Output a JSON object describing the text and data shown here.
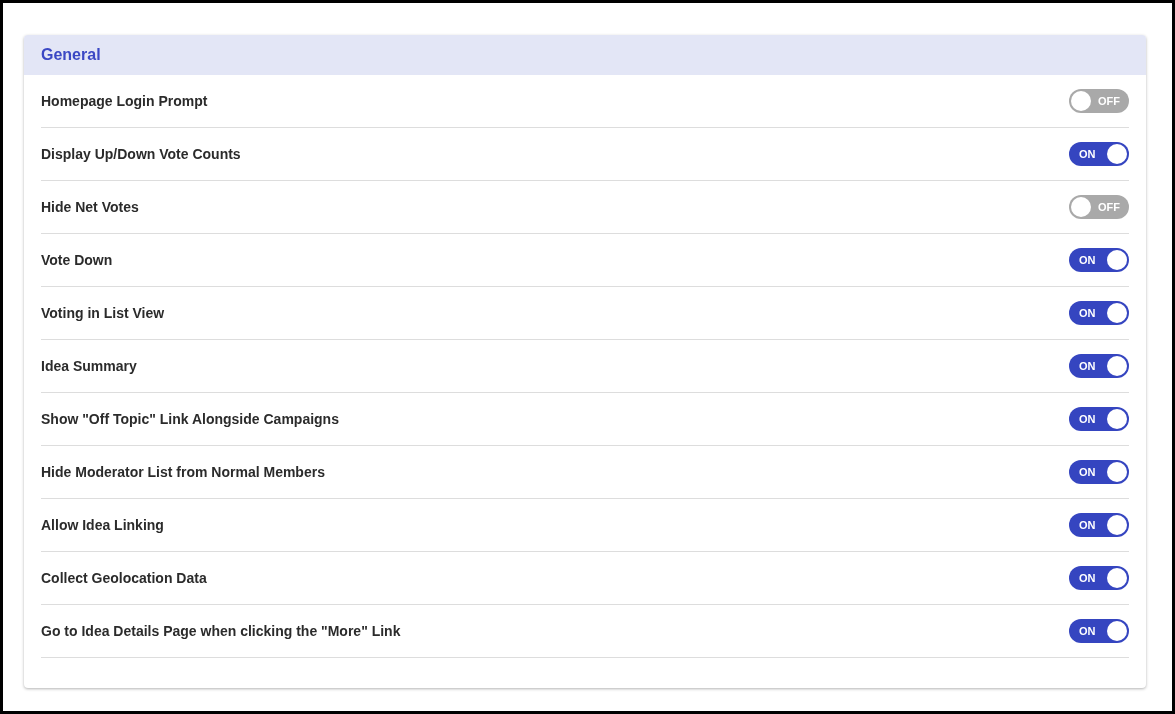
{
  "section": {
    "title": "General"
  },
  "settings": [
    {
      "label": "Homepage Login Prompt",
      "on": false,
      "state_text": "OFF"
    },
    {
      "label": "Display Up/Down Vote Counts",
      "on": true,
      "state_text": "ON"
    },
    {
      "label": "Hide Net Votes",
      "on": false,
      "state_text": "OFF"
    },
    {
      "label": "Vote Down",
      "on": true,
      "state_text": "ON"
    },
    {
      "label": "Voting in List View",
      "on": true,
      "state_text": "ON"
    },
    {
      "label": "Idea Summary",
      "on": true,
      "state_text": "ON"
    },
    {
      "label": "Show \"Off Topic\" Link Alongside Campaigns",
      "on": true,
      "state_text": "ON"
    },
    {
      "label": "Hide Moderator List from Normal Members",
      "on": true,
      "state_text": "ON"
    },
    {
      "label": "Allow Idea Linking",
      "on": true,
      "state_text": "ON"
    },
    {
      "label": "Collect Geolocation Data",
      "on": true,
      "state_text": "ON"
    },
    {
      "label": "Go to Idea Details Page when clicking the \"More\" Link",
      "on": true,
      "state_text": "ON"
    }
  ]
}
